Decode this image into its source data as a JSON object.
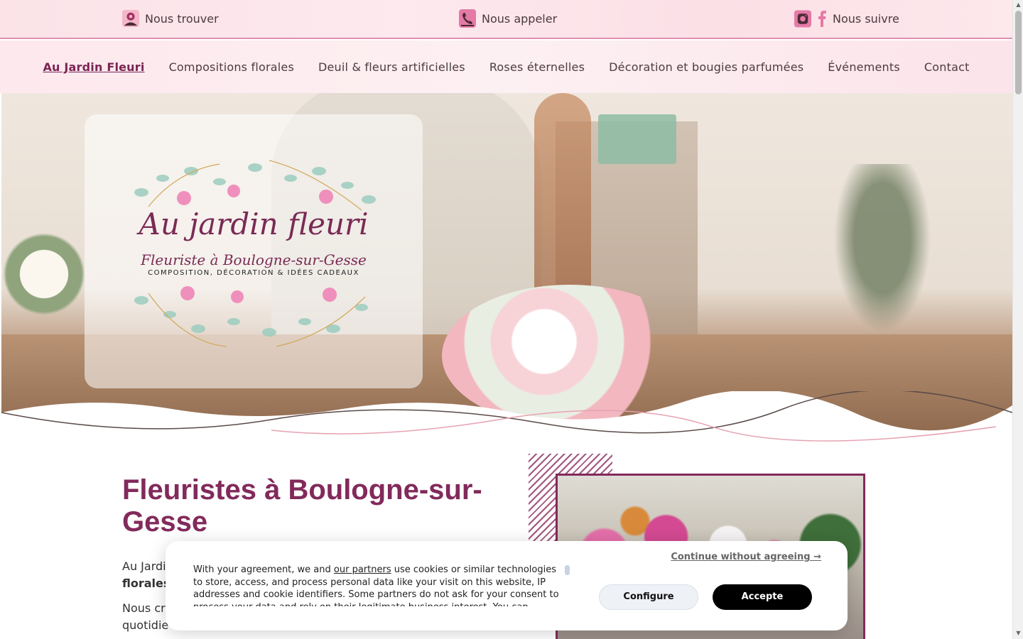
{
  "topbar": {
    "find_label": "Nous trouver",
    "call_label": "Nous appeler",
    "follow_label": "Nous suivre"
  },
  "nav": {
    "items": [
      {
        "label": "Au Jardin Fleuri",
        "active": true
      },
      {
        "label": "Compositions florales"
      },
      {
        "label": "Deuil & fleurs artificielles"
      },
      {
        "label": "Roses éternelles"
      },
      {
        "label": "Décoration et bougies parfumées"
      },
      {
        "label": "Événements"
      },
      {
        "label": "Contact"
      }
    ]
  },
  "hero": {
    "logo_title": "Au jardin fleuri",
    "logo_subtitle": "Fleuriste à Boulogne-sur-Gesse",
    "logo_tagline": "COMPOSITION, DÉCORATION & IDÉES CADEAUX"
  },
  "content": {
    "title": "Fleuristes à Boulogne-sur-Gesse",
    "p1_start": "Au Jardi",
    "p1_bold": "florales",
    "p2_start": "Nous cr",
    "p2_line2": "quotidie"
  },
  "cookie": {
    "text_before_link": "With your agreement, we and ",
    "link_text": "our partners",
    "text_after_link": " use cookies or similar technologies to store, access, and process personal data like your visit on this website, IP addresses and cookie identifiers. Some partners do not ask for your consent to process your data and rely on their legitimate business interest. You can",
    "continue_label": "Continue without agreeing →",
    "configure_label": "Configure",
    "accept_label": "Accepte"
  },
  "colors": {
    "brand": "#822a5b",
    "topbar_bg": "#fbe3e8",
    "accept_bg": "#000000"
  },
  "icons": {
    "find": "map-pin-icon",
    "call": "phone-icon",
    "instagram": "instagram-icon",
    "facebook": "facebook-icon"
  }
}
